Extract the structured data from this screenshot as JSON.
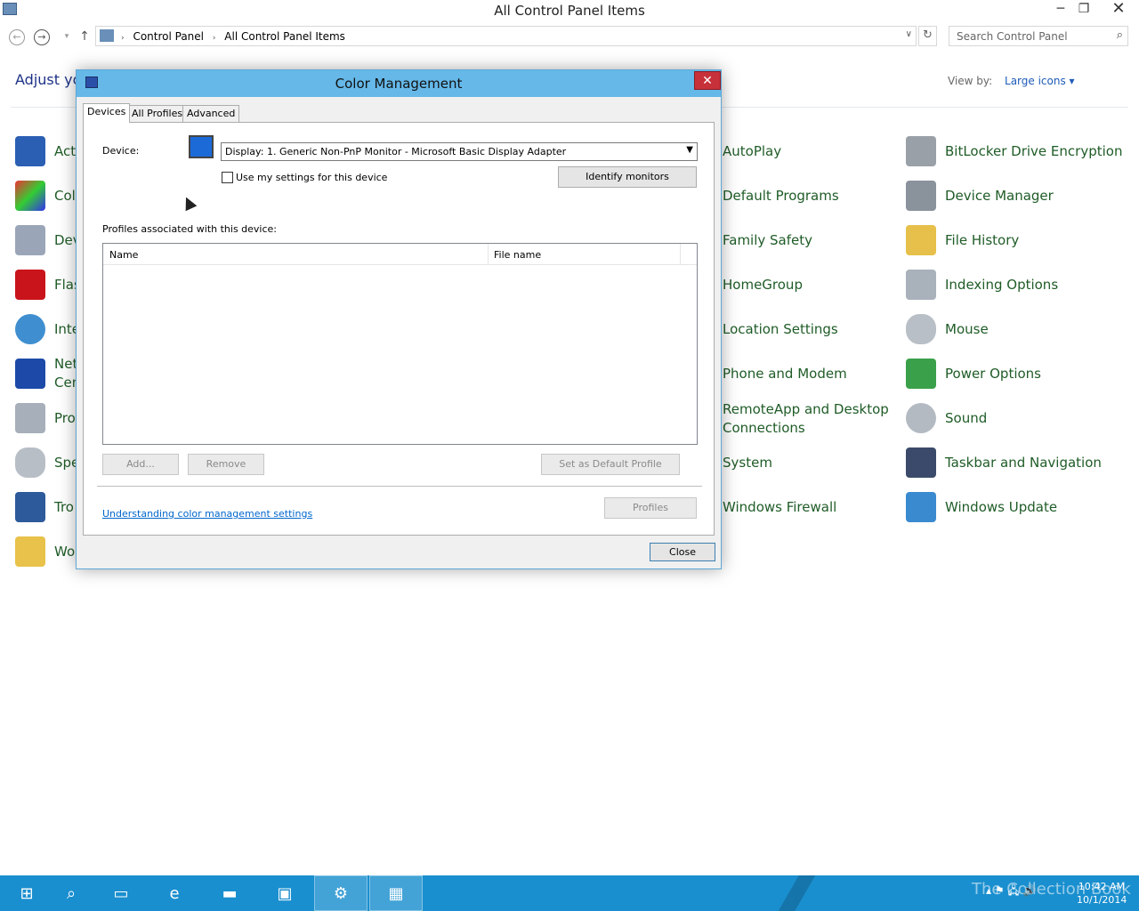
{
  "window": {
    "title": "All Control Panel Items",
    "minimize": "─",
    "maximize": "❐",
    "close": "✕"
  },
  "nav": {
    "back": "←",
    "forward": "→",
    "history": "▾",
    "up": "↑",
    "crumb_sep": "›",
    "breadcrumbs": [
      "Control Panel",
      "All Control Panel Items"
    ],
    "address_dropdown": "∨",
    "refresh": "↻",
    "search_placeholder": "Search Control Panel",
    "search_icon": "⌕"
  },
  "header": {
    "adjust_text": "Adjust yo",
    "view_by_label": "View by:",
    "view_by_value": "Large icons ▾"
  },
  "cp_items_left": [
    "Act",
    "Col",
    "Dev",
    "Flas",
    "Inte",
    "Net\nCen",
    "Pro",
    "Spe",
    "Tro",
    "Wo"
  ],
  "cp_items_mid": [
    "AutoPlay",
    "Default Programs",
    "Family Safety",
    "HomeGroup",
    "Location Settings",
    "Phone and Modem",
    "RemoteApp and Desktop Connections",
    "System",
    "Windows Firewall"
  ],
  "cp_items_right": [
    "BitLocker Drive Encryption",
    "Device Manager",
    "File History",
    "Indexing Options",
    "Mouse",
    "Power Options",
    "Sound",
    "Taskbar and Navigation",
    "Windows Update"
  ],
  "dialog": {
    "title": "Color Management",
    "close_x": "✕",
    "tabs": [
      "Devices",
      "All Profiles",
      "Advanced"
    ],
    "device_label": "Device:",
    "device_value": "Display: 1. Generic Non-PnP Monitor - Microsoft Basic Display Adapter",
    "device_dropdown": "▼",
    "use_settings_label": "Use my settings for this device",
    "identify_button": "Identify monitors",
    "profiles_label": "Profiles associated with this device:",
    "columns": [
      "Name",
      "File name"
    ],
    "add_button": "Add...",
    "remove_button": "Remove",
    "default_button": "Set as Default Profile",
    "link": "Understanding color management settings",
    "profiles_button": "Profiles",
    "close_button": "Close"
  },
  "taskbar": {
    "items": [
      "⊞",
      "⌕",
      "▭",
      "e",
      "▬",
      "▣",
      "⚙",
      "▦"
    ],
    "tray": "▴ ⚑ 🖧 🔊",
    "watermark": "The Collection Book",
    "time": "10:42 AM",
    "date": "10/1/2014"
  }
}
